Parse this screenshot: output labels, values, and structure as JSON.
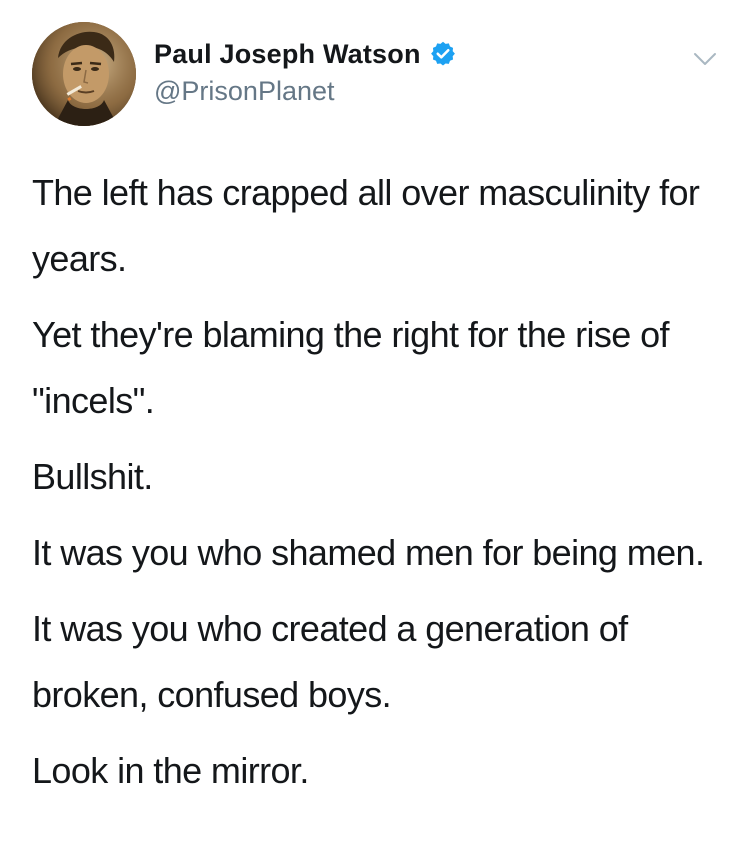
{
  "author": {
    "display_name": "Paul Joseph Watson",
    "handle": "@PrisonPlanet",
    "verified": true,
    "avatar_icon": "profile-photo"
  },
  "tweet": {
    "paragraphs": [
      "The left has crapped all over masculinity for years.",
      "Yet they're blaming the right for the rise of \"incels\".",
      "Bullshit.",
      "It was you who shamed men for being men.",
      "It was you who created a generation of broken, confused boys.",
      "Look in the mirror."
    ]
  },
  "colors": {
    "verified_badge": "#1da1f2",
    "handle_text": "#657786",
    "caret": "#aab8c2",
    "text": "#14171a"
  },
  "icons": {
    "verified": "verified-badge-icon",
    "more": "chevron-down-icon"
  }
}
